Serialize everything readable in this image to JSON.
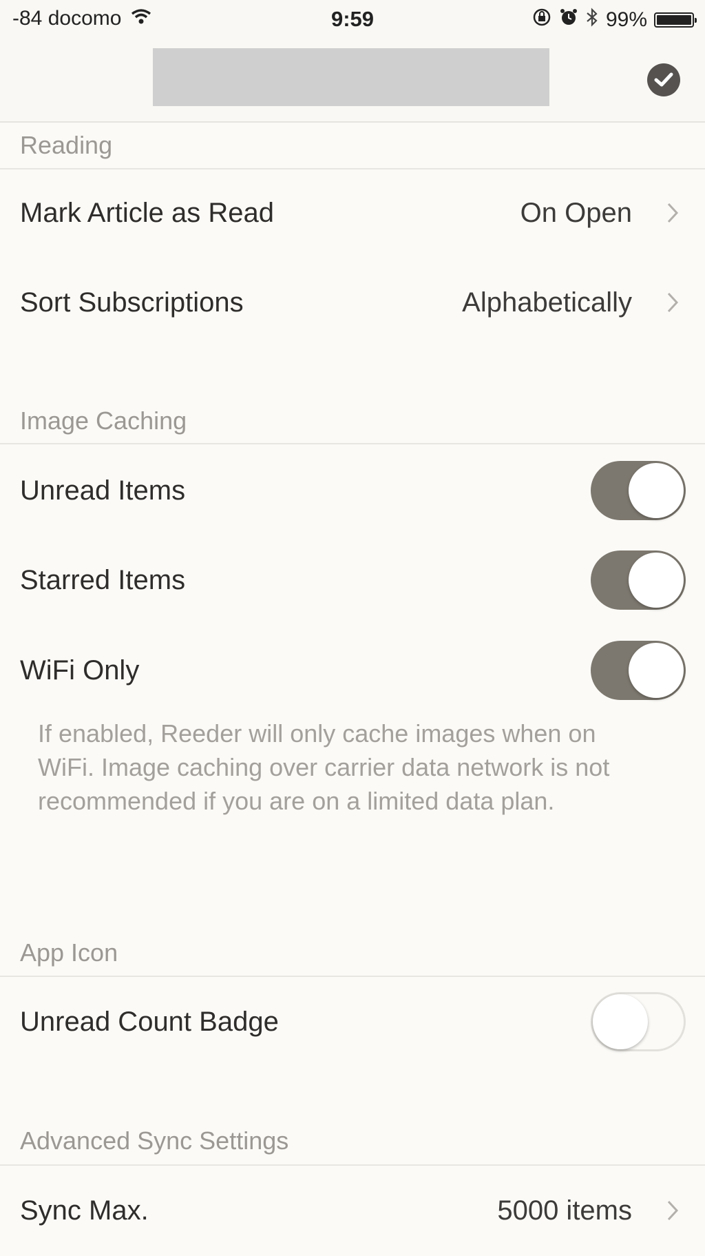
{
  "status_bar": {
    "carrier": "-84 docomo",
    "time": "9:59",
    "battery": "99%",
    "battery_level": 0.99
  },
  "sections": {
    "reading": {
      "header": "Reading",
      "mark_read": {
        "label": "Mark Article as Read",
        "value": "On Open"
      },
      "sort_subscriptions": {
        "label": "Sort Subscriptions",
        "value": "Alphabetically"
      }
    },
    "image_caching": {
      "header": "Image Caching",
      "unread_items": {
        "label": "Unread Items",
        "on": true
      },
      "starred_items": {
        "label": "Starred Items",
        "on": true
      },
      "wifi_only": {
        "label": "WiFi Only",
        "on": true
      },
      "footnote": "If enabled, Reeder will only cache images when on WiFi. Image caching over carrier data network is not recommended if you are on a limited data plan."
    },
    "app_icon": {
      "header": "App Icon",
      "unread_count_badge": {
        "label": "Unread Count Badge",
        "on": false
      }
    },
    "advanced_sync": {
      "header": "Advanced Sync Settings",
      "sync_max": {
        "label": "Sync Max.",
        "value": "5000 items"
      }
    }
  },
  "colors": {
    "background": "#fbfaf7",
    "toggle_on": "#7d786f",
    "section_header": "#9b9894"
  }
}
